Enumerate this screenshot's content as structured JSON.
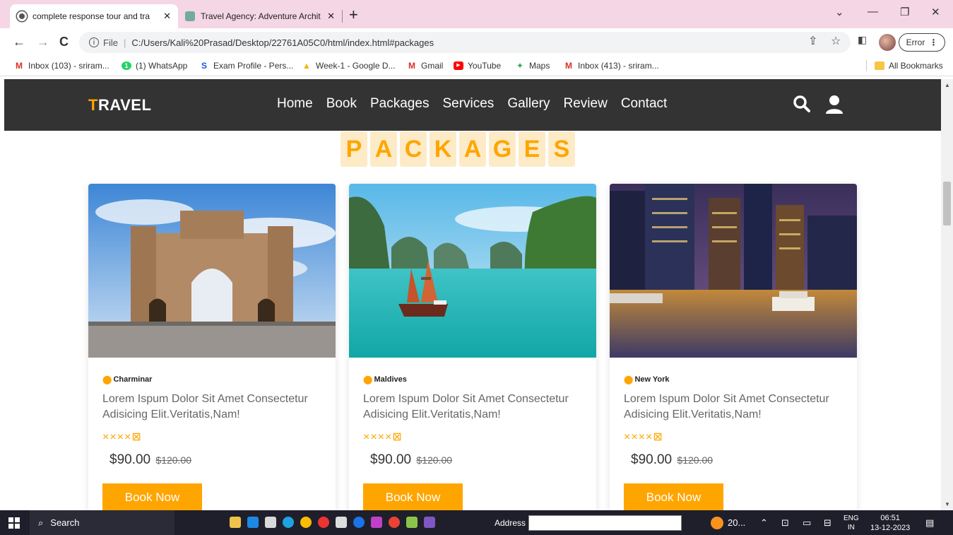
{
  "browser": {
    "tabs": [
      {
        "title": "complete response tour and tra",
        "active": true
      },
      {
        "title": "Travel Agency: Adventure Archit",
        "active": false
      }
    ],
    "new_tab": "+",
    "url_prefix": "File",
    "url": "C:/Users/Kali%20Prasad/Desktop/22761A05C0/html/index.html#packages",
    "error_label": "Error",
    "bookmarks": [
      {
        "label": "Inbox (103) - sriram...",
        "icon": "gmail-icon"
      },
      {
        "label": "(1) WhatsApp",
        "icon": "whatsapp-icon"
      },
      {
        "label": "Exam Profile - Pers...",
        "icon": "s-icon"
      },
      {
        "label": "Week-1 - Google D...",
        "icon": "drive-icon"
      },
      {
        "label": "Gmail",
        "icon": "gmail-icon"
      },
      {
        "label": "YouTube",
        "icon": "youtube-icon"
      },
      {
        "label": "Maps",
        "icon": "maps-icon"
      },
      {
        "label": "Inbox (413) - sriram...",
        "icon": "gmail-icon"
      }
    ],
    "all_bookmarks": "All Bookmarks"
  },
  "site": {
    "logo_first": "T",
    "logo_rest": "RAVEL",
    "nav": [
      "Home",
      "Book",
      "Packages",
      "Services",
      "Gallery",
      "Review",
      "Contact"
    ],
    "heading_letters": [
      "P",
      "A",
      "C",
      "K",
      "A",
      "G",
      "E",
      "S"
    ],
    "cards": [
      {
        "location": "Charminar",
        "desc": "Lorem Ispum Dolor Sit Amet Consectetur Adisicing Elit.Veritatis,Nam!",
        "stars": "××××⊠",
        "price": "$90.00",
        "old_price": "$120.00",
        "button": "Book Now"
      },
      {
        "location": "Maldives",
        "desc": "Lorem Ispum Dolor Sit Amet Consectetur Adisicing Elit.Veritatis,Nam!",
        "stars": "××××⊠",
        "price": "$90.00",
        "old_price": "$120.00",
        "button": "Book Now"
      },
      {
        "location": "New York",
        "desc": "Lorem Ispum Dolor Sit Amet Consectetur Adisicing Elit.Veritatis,Nam!",
        "stars": "××××⊠",
        "price": "$90.00",
        "old_price": "$120.00",
        "button": "Book Now"
      }
    ]
  },
  "taskbar": {
    "search": "Search",
    "address_label": "Address",
    "weather": "20...",
    "lang_top": "ENG",
    "lang_bottom": "IN",
    "time": "06:51",
    "date": "13-12-2023"
  },
  "colors": {
    "accent": "#ffa500",
    "header_bg": "#333333",
    "tab_strip": "#f5d6e4"
  }
}
